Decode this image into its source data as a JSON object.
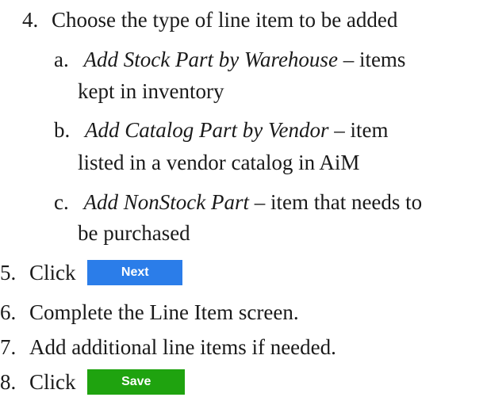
{
  "steps": [
    {
      "number": "4.",
      "text": "Choose the type of line item to be added",
      "substeps": [
        {
          "letter": "a.",
          "title": "Add Stock Part by Warehouse",
          "desc_line1": " – items",
          "desc_line2": "kept in inventory"
        },
        {
          "letter": "b.",
          "title": "Add Catalog Part by Vendor",
          "desc_line1": " – item",
          "desc_line2": "listed in a vendor catalog in AiM"
        },
        {
          "letter": "c.",
          "title": "Add NonStock Part",
          "desc_line1": " – item that needs to",
          "desc_line2": "be purchased"
        }
      ]
    },
    {
      "number": "5.",
      "text": "Click",
      "button": "Next"
    },
    {
      "number": "6.",
      "text": "Complete the Line Item screen."
    },
    {
      "number": "7.",
      "text": "Add additional line items if needed."
    },
    {
      "number": "8.",
      "text": "Click",
      "button": "Save"
    }
  ],
  "colors": {
    "next_button": "#2b7de9",
    "save_button": "#1fa30f"
  }
}
